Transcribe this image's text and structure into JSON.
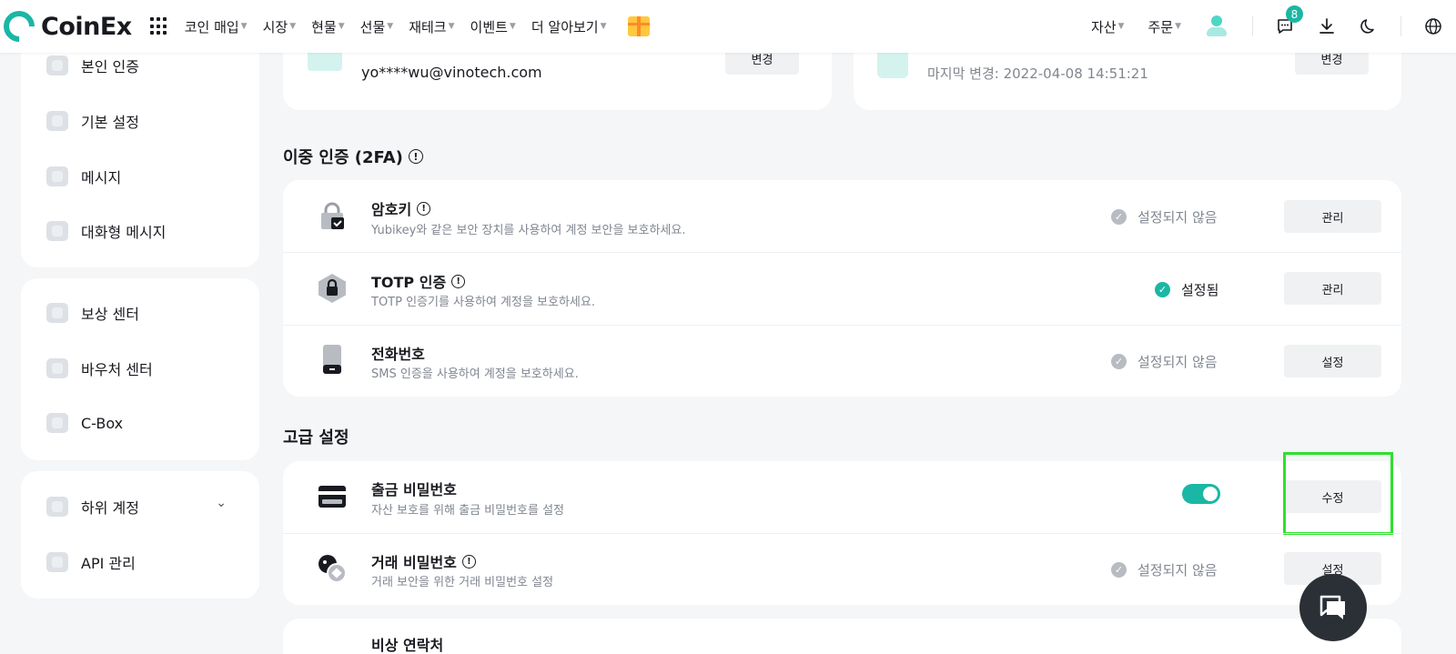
{
  "header": {
    "logo_text": "CoinEx",
    "nav": [
      {
        "label": "코인 매입"
      },
      {
        "label": "시장"
      },
      {
        "label": "현물"
      },
      {
        "label": "선물"
      },
      {
        "label": "재테크"
      },
      {
        "label": "이벤트"
      },
      {
        "label": "더 알아보기"
      }
    ],
    "right": {
      "assets": "자산",
      "orders": "주문",
      "message_badge": "8"
    }
  },
  "sidebar": {
    "group1": [
      {
        "label": "본인 인증",
        "icon": "id-card-icon"
      },
      {
        "label": "기본 설정",
        "icon": "settings-icon"
      },
      {
        "label": "메시지",
        "icon": "message-icon"
      },
      {
        "label": "대화형 메시지",
        "icon": "chat-icon"
      }
    ],
    "group2": [
      {
        "label": "보상 센터",
        "icon": "gift-icon"
      },
      {
        "label": "바우처 센터",
        "icon": "voucher-icon"
      },
      {
        "label": "C-Box",
        "icon": "box-icon"
      }
    ],
    "group3": [
      {
        "label": "하위 계정",
        "icon": "sub-account-icon"
      },
      {
        "label": "API 관리",
        "icon": "api-icon"
      }
    ]
  },
  "top_cards": {
    "email_value": "yo****wu@vinotech.com",
    "email_button": "변경",
    "password_last_changed": "마지막 변경: 2022-04-08 14:51:21",
    "password_button": "변경"
  },
  "twofa": {
    "title": "이중 인증 (2FA)",
    "rows": [
      {
        "title": "암호키",
        "desc": "Yubikey와 같은 보안 장치를 사용하여 계정 보안을 보호하세요.",
        "status": "설정되지 않음",
        "button": "관리"
      },
      {
        "title": "TOTP 인증",
        "desc": "TOTP 인증기를 사용하여 계정을 보호하세요.",
        "status": "설정됨",
        "button": "관리"
      },
      {
        "title": "전화번호",
        "desc": "SMS 인증을 사용하여 계정을 보호하세요.",
        "status": "설정되지 않음",
        "button": "설정"
      }
    ]
  },
  "advanced": {
    "title": "고급 설정",
    "rows": [
      {
        "title": "출금 비밀번호",
        "desc": "자산 보호를 위해 출금 비밀번호를 설정",
        "toggle_on": true,
        "button": "수정"
      },
      {
        "title": "거래 비밀번호",
        "desc": "거래 보안을 위한 거래 비밀번호 설정",
        "status": "설정되지 않음",
        "button": "설정"
      }
    ],
    "partial_title": "비상 연락처"
  },
  "colors": {
    "accent": "#1ab7a4",
    "status_gray": "#b8bcc2",
    "highlight": "#2ee02e"
  }
}
